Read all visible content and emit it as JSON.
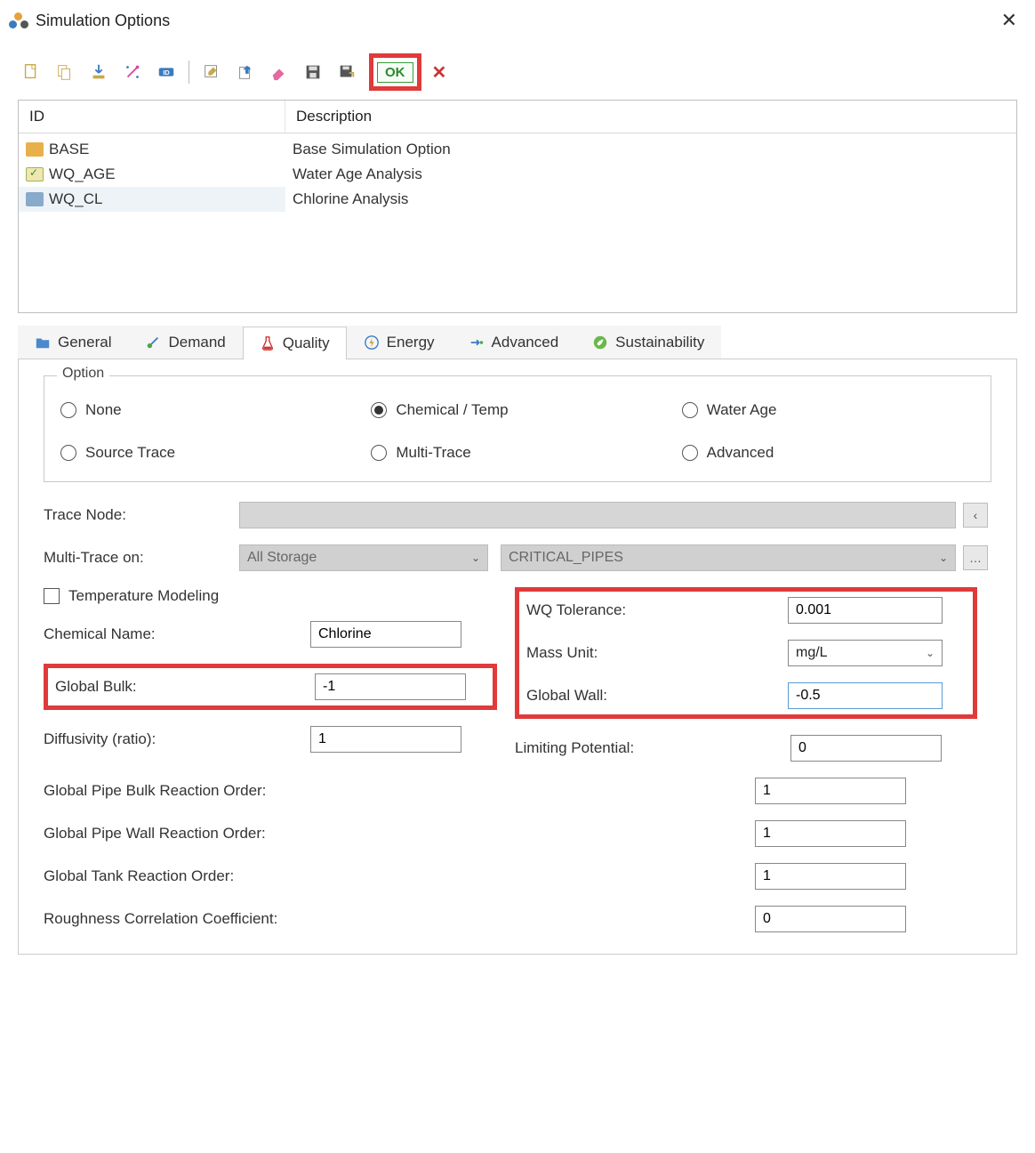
{
  "window": {
    "title": "Simulation Options"
  },
  "toolbar": {
    "ok_label": "OK"
  },
  "list": {
    "headers": {
      "id": "ID",
      "description": "Description"
    },
    "rows": [
      {
        "id": "BASE",
        "description": "Base Simulation Option",
        "icon": "f-yellow"
      },
      {
        "id": "WQ_AGE",
        "description": "Water Age Analysis",
        "icon": "f-check"
      },
      {
        "id": "WQ_CL",
        "description": "Chlorine Analysis",
        "icon": "f-blue",
        "selected": true
      }
    ]
  },
  "tabs": {
    "items": [
      {
        "label": "General"
      },
      {
        "label": "Demand"
      },
      {
        "label": "Quality",
        "active": true
      },
      {
        "label": "Energy"
      },
      {
        "label": "Advanced"
      },
      {
        "label": "Sustainability"
      }
    ]
  },
  "quality": {
    "option_legend": "Option",
    "radios": {
      "none": "None",
      "chemical_temp": "Chemical / Temp",
      "water_age": "Water Age",
      "source_trace": "Source Trace",
      "multi_trace": "Multi-Trace",
      "advanced": "Advanced",
      "selected": "chemical_temp"
    },
    "trace_node_label": "Trace Node:",
    "trace_node_value": "",
    "multi_trace_on_label": "Multi-Trace on:",
    "multi_trace_select1": "All Storage",
    "multi_trace_select2": "CRITICAL_PIPES",
    "temp_modeling_label": "Temperature Modeling",
    "chemical_name_label": "Chemical Name:",
    "chemical_name_value": "Chlorine",
    "global_bulk_label": "Global Bulk:",
    "global_bulk_value": "-1",
    "diffusivity_label": "Diffusivity (ratio):",
    "diffusivity_value": "1",
    "wq_tol_label": "WQ Tolerance:",
    "wq_tol_value": "0.001",
    "mass_unit_label": "Mass Unit:",
    "mass_unit_value": "mg/L",
    "global_wall_label": "Global Wall:",
    "global_wall_value": "-0.5",
    "limiting_pot_label": "Limiting Potential:",
    "limiting_pot_value": "0",
    "pipe_bulk_order_label": "Global Pipe Bulk Reaction Order:",
    "pipe_bulk_order_value": "1",
    "pipe_wall_order_label": "Global Pipe Wall Reaction Order:",
    "pipe_wall_order_value": "1",
    "tank_order_label": "Global Tank Reaction Order:",
    "tank_order_value": "1",
    "rough_corr_label": "Roughness Correlation Coefficient:",
    "rough_corr_value": "0"
  }
}
